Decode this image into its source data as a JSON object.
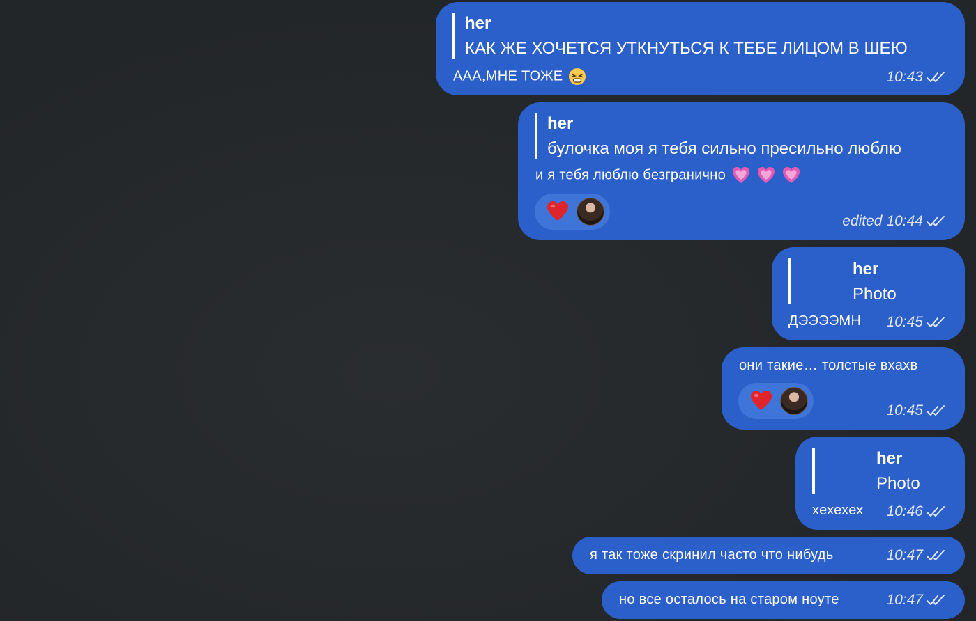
{
  "messages": [
    {
      "reply_name": "her",
      "reply_text": "КАК ЖЕ ХОЧЕТСЯ УТКНУТЬСЯ К ТЕБЕ ЛИЦОМ В ШЕЮ",
      "text": "ААА,МНЕ ТОЖЕ",
      "text_emoji": "tired-face-emoji",
      "time": "10:43"
    },
    {
      "reply_name": "her",
      "reply_text": "булочка моя я тебя сильно пресильно люблю",
      "text": "и я тебя люблю безгранично",
      "text_emoji": "heart-pink-emoji x3",
      "edited": "edited",
      "time": "10:44",
      "reaction": "red-heart"
    },
    {
      "reply_name": "her",
      "reply_text": "Photo",
      "text": "ДЭЭЭЭМН",
      "time": "10:45"
    },
    {
      "text": "они такие… толстые вхахв",
      "time": "10:45",
      "reaction": "red-heart"
    },
    {
      "reply_name": "her",
      "reply_text": "Photo",
      "text": "хехехех",
      "time": "10:46"
    },
    {
      "text": "я так тоже скринил часто что нибудь",
      "time": "10:47"
    },
    {
      "text": "но все осталось на старом ноуте",
      "time": "10:47"
    }
  ],
  "colors": {
    "background": "#25282b",
    "bubble": "#2b5fc9",
    "reaction_pill": "#3f74d8",
    "meta_text": "#dfe7f9"
  }
}
